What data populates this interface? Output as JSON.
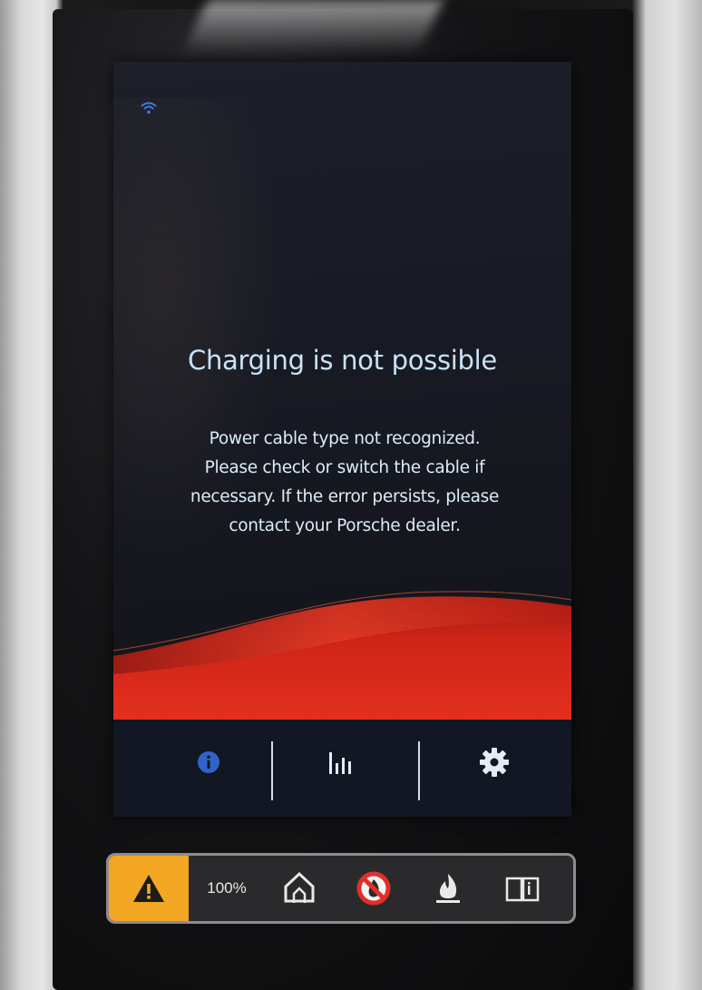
{
  "screen": {
    "status_icon": "wifi-icon",
    "title": "Charging is not possible",
    "message": [
      "Power cable type not recognized.",
      "Please check or switch the cable if",
      "necessary. If the error persists, please",
      "contact your Porsche dealer."
    ]
  },
  "navbar": {
    "items": [
      {
        "icon": "info-icon",
        "color": "#2f63c9"
      },
      {
        "icon": "bar-chart-icon",
        "color": "#e6ebf2"
      },
      {
        "icon": "gear-icon",
        "color": "#e6ebf2"
      }
    ]
  },
  "status_strip": {
    "warning_icon": "warning-icon",
    "warning_color": "#f2a623",
    "percentage": "100%",
    "icons": [
      "house-power-icon",
      "no-fire-icon",
      "flame-icon",
      "manual-icon"
    ],
    "prohibition_color": "#e0302c"
  },
  "colors": {
    "accent_red": "#d8261c",
    "title_text": "#c9e2f7"
  }
}
